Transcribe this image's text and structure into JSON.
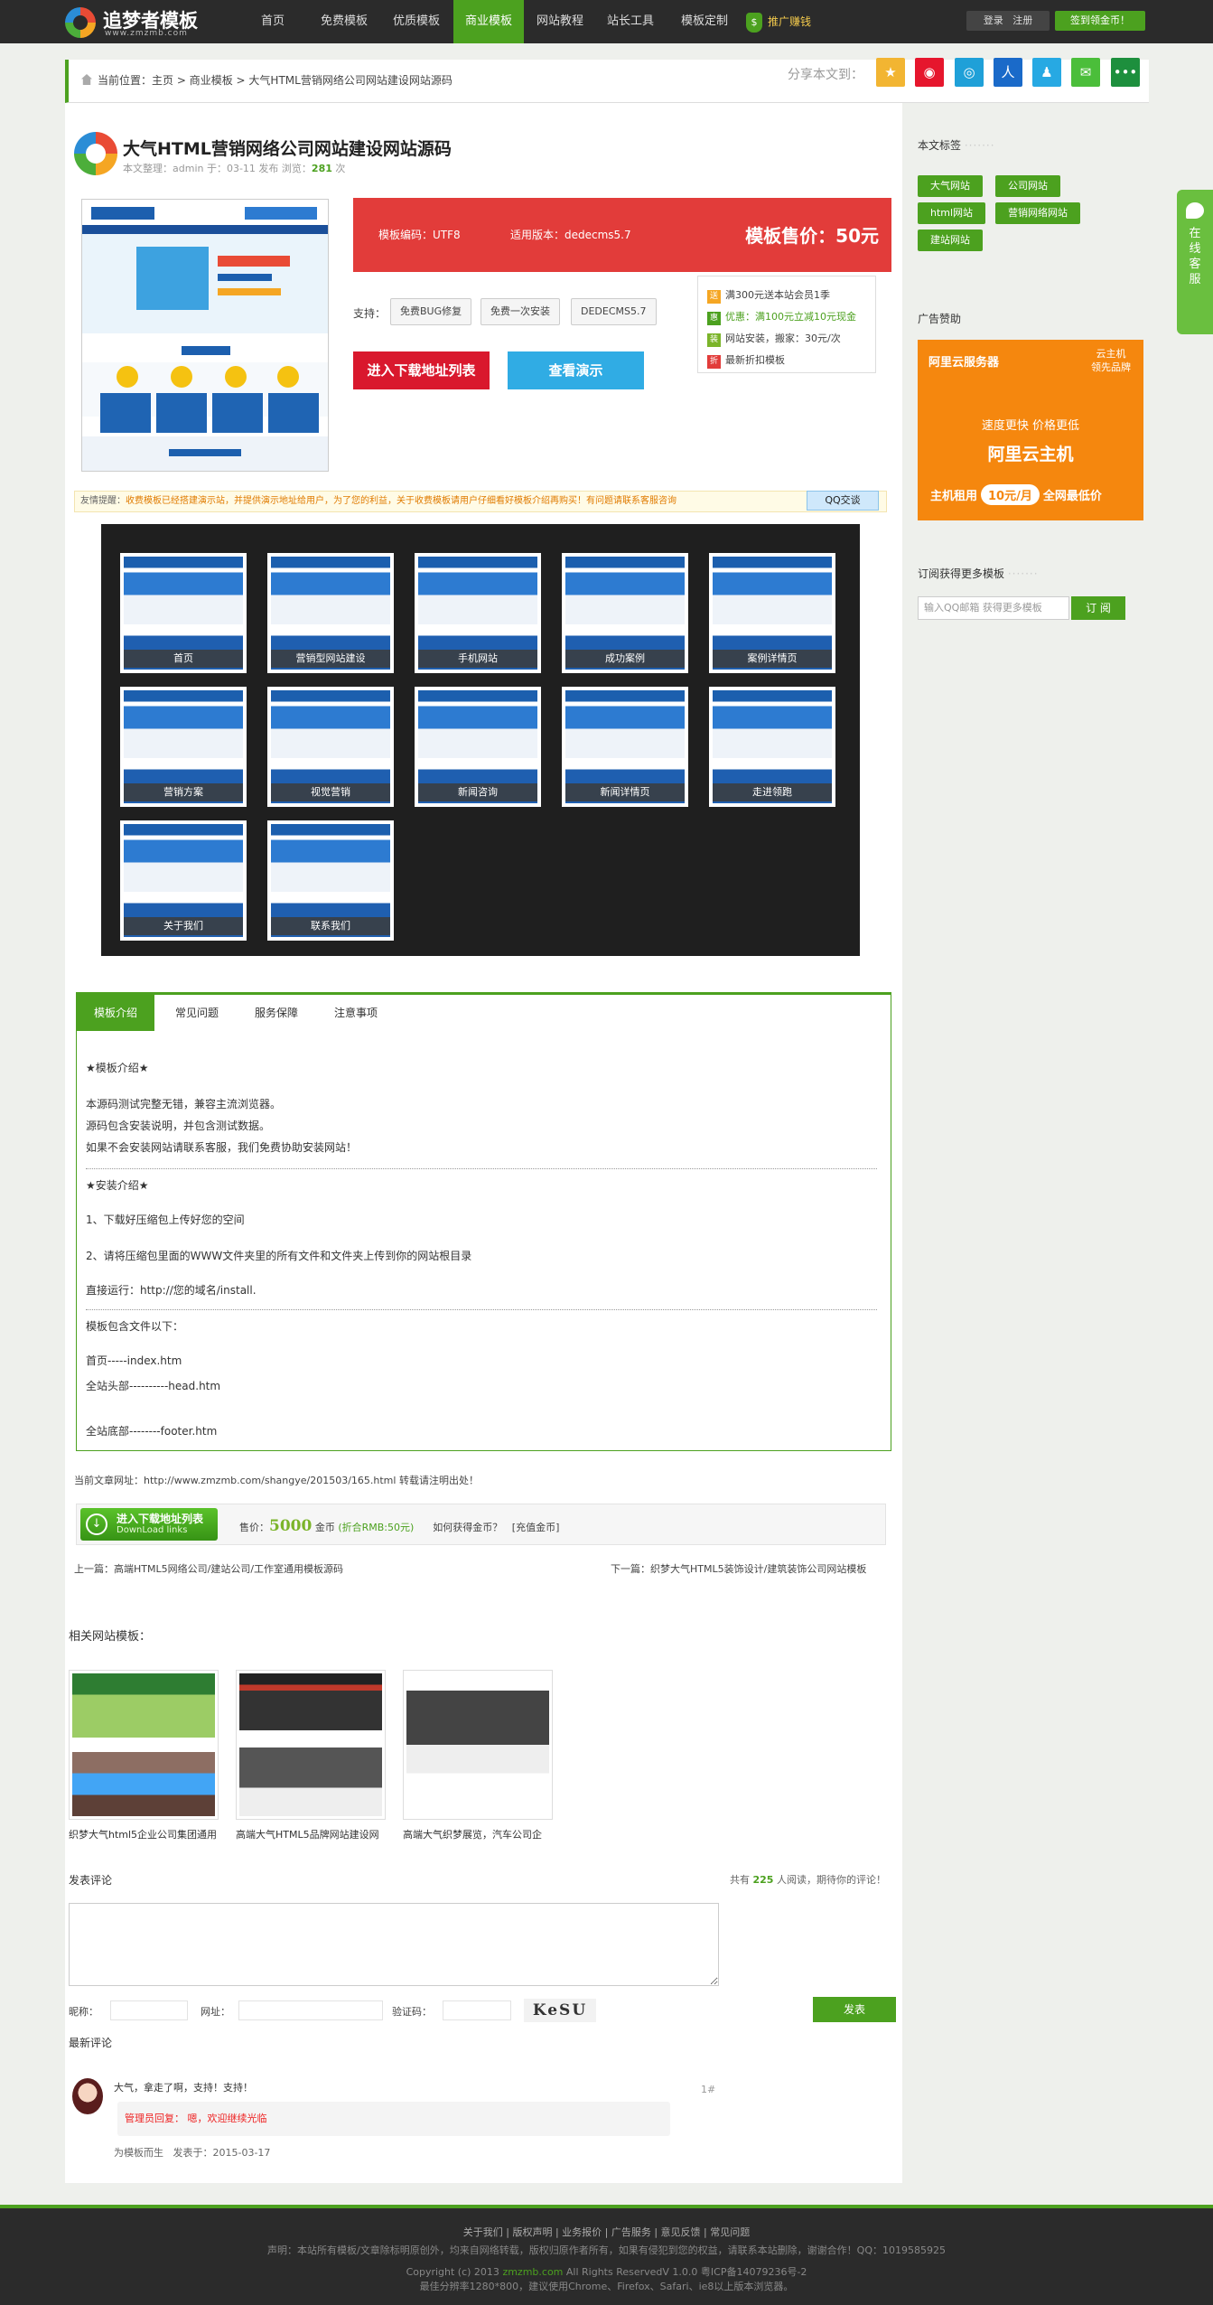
{
  "header": {
    "logo_title": "追梦者模板",
    "logo_sub": "www.zmzmb.com",
    "nav": [
      "首页",
      "免费模板",
      "优质模板",
      "商业模板",
      "网站教程",
      "站长工具",
      "模板定制"
    ],
    "active_index": 3,
    "promo": "推广赚钱",
    "login": "登录",
    "register": "注册",
    "signin": "签到领金币！"
  },
  "breadcrumb": {
    "prefix": "当前位置：",
    "home": "主页",
    "sep": " > ",
    "category": "商业模板",
    "current": "大气HTML营销网络公司网站建设网站源码"
  },
  "share": {
    "label": "分享本文到："
  },
  "product": {
    "title": "大气HTML营销网络公司网站建设网站源码",
    "meta_prefix": "本文整理：admin  于：03-11 发布  浏览：",
    "views": "281",
    "meta_suffix": "次",
    "encoding": "模板编码：UTF8",
    "version": "适用版本：dedecms5.7",
    "price": "模板售价：50元",
    "support_label": "支持：",
    "support_tags": [
      "免费BUG修复",
      "免费一次安装",
      "DEDECMS5.7"
    ],
    "download_btn": "进入下载地址列表",
    "demo_btn": "查看演示"
  },
  "promo_box": [
    {
      "icon": "送",
      "text": "满300元送本站会员1季"
    },
    {
      "icon": "惠",
      "text": "优惠：满100元立减10元现金"
    },
    {
      "icon": "装",
      "text": "网站安装，搬家：30元/次"
    },
    {
      "icon": "折",
      "text": "最新折扣模板"
    }
  ],
  "tip": {
    "lead": "友情提醒：",
    "text": "收费模板已经搭建演示站，并提供演示地址给用户，为了您的利益，关于收费模板请用户仔细看好模板介绍再购买！有问题请联系客服咨询",
    "qq": "QQ交谈"
  },
  "gallery": [
    "首页",
    "营销型网站建设",
    "手机网站",
    "成功案例",
    "案例详情页",
    "营销方案",
    "视觉营销",
    "新闻咨询",
    "新闻详情页",
    "走进领跑",
    "关于我们",
    "联系我们"
  ],
  "tabs": {
    "labels": [
      "模板介绍",
      "常见问题",
      "服务保障",
      "注意事项"
    ],
    "intro_title": "★模板介绍★",
    "intro_lines": [
      "本源码测试完整无错，兼容主流浏览器。",
      "源码包含安装说明，并包含测试数据。",
      "如果不会安装网站请联系客服，我们免费协助安装网站！"
    ],
    "install_title": "★安装介绍★",
    "install_lines": [
      "1、下载好压缩包上传好您的空间",
      "2、请将压缩包里面的WWW文件夹里的所有文件和文件夹上传到你的网站根目录",
      "直接运行：http://您的域名/install."
    ],
    "files_title": "模板包含文件以下：",
    "files": [
      "首页-----index.htm",
      "全站头部----------head.htm",
      "全站底部--------footer.htm"
    ]
  },
  "article_url": {
    "prefix": "当前文章网址：",
    "url": "http://www.zmzmb.com/shangye/201503/165.html",
    "suffix": " 转载请注明出处！"
  },
  "download_bar": {
    "btn_l1": "进入下载地址列表",
    "btn_l2": "DownLoad links",
    "price_label": "售价：",
    "gold": "5000",
    "gold_unit": " 金币",
    "rmb": "(折合RMB:50元)",
    "how": "如何获得金币？",
    "recharge": "[充值金币]"
  },
  "prev_next": {
    "prev": "上一篇：高端HTML5网络公司/建站公司/工作室通用模板源码",
    "next": "下一篇：织梦大气HTML5装饰设计/建筑装饰公司网站模板"
  },
  "related": {
    "title": "相关网站模板：",
    "items": [
      "织梦大气html5企业公司集团通用",
      "高端大气HTML5品牌网站建设网",
      "高端大气织梦展览，汽车公司企"
    ]
  },
  "comment": {
    "title": "发表评论",
    "count_prefix": "共有 ",
    "count": "225",
    "count_suffix": " 人阅读，期待你的评论！",
    "nick": "昵称：",
    "site": "网址：",
    "code": "验证码：",
    "captcha": "KeSU",
    "submit": "发表",
    "latest": "最新评论",
    "body": "大气，拿走了啊，支持！支持！",
    "floor": "1#",
    "reply": "管理员回复：  嗯，欢迎继续光临",
    "author": "为模板而生",
    "date": "发表于：2015-03-17"
  },
  "sidebar": {
    "tags_title": "本文标签",
    "tags": [
      "大气网站",
      "公司网站",
      "html网站",
      "营销网络网站",
      "建站网站"
    ],
    "ad_title": "广告赞助",
    "ad": {
      "brand": "阿里云服务器",
      "corner1": "云主机",
      "corner2": "领先品牌",
      "line1": "速度更快   价格更低",
      "big": "阿里云主机",
      "bot_prefix": "主机租用",
      "bot_price": "10元/月",
      "bot_suffix": "全网最低价"
    },
    "sub_title": "订阅获得更多模板",
    "sub_placeholder": "输入QQ邮箱 获得更多模板",
    "sub_btn": "订 阅"
  },
  "online": "在线客服",
  "footer": {
    "links": "关于我们  |  版权声明  |  业务报价  |  广告服务  |  意见反馈  |  常见问题",
    "notice": "声明：本站所有模板/文章除标明原创外，均来自网络转载，版权归原作者所有，如果有侵犯到您的权益，请联系本站删除，谢谢合作！QQ：1019585925",
    "copy_prefix": "Copyright (c) 2013 ",
    "copy_domain": "zmzmb.com",
    "copy_suffix": " All Rights ReservedV 1.0.0    粤ICP备14079236号-2",
    "best": "最佳分辨率1280*800，建议使用Chrome、Firefox、Safari、ie8以上版本浏览器。"
  },
  "colors": {
    "brand_green": "#4ca11f",
    "price_red": "#e23c3a",
    "demo_blue": "#30ace4",
    "ad_orange": "#f5870e"
  }
}
